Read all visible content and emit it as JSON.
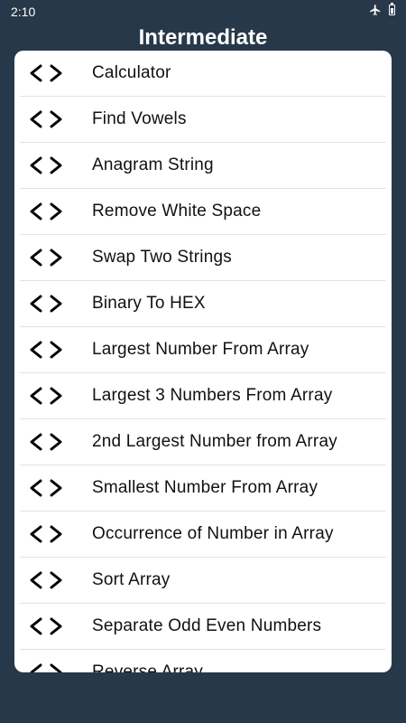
{
  "status_bar": {
    "time": "2:10",
    "icons": [
      "airplane-icon",
      "battery-icon"
    ]
  },
  "header": {
    "title": "Intermediate"
  },
  "list": {
    "items": [
      {
        "label": "Calculator",
        "icon": "code-icon"
      },
      {
        "label": "Find Vowels",
        "icon": "code-icon"
      },
      {
        "label": "Anagram String",
        "icon": "code-icon"
      },
      {
        "label": "Remove White Space",
        "icon": "code-icon"
      },
      {
        "label": "Swap Two Strings",
        "icon": "code-icon"
      },
      {
        "label": "Binary To HEX",
        "icon": "code-icon"
      },
      {
        "label": "Largest Number From Array",
        "icon": "code-icon"
      },
      {
        "label": "Largest 3 Numbers From Array",
        "icon": "code-icon"
      },
      {
        "label": "2nd Largest Number from Array",
        "icon": "code-icon"
      },
      {
        "label": "Smallest Number From Array",
        "icon": "code-icon"
      },
      {
        "label": "Occurrence of Number in Array",
        "icon": "code-icon"
      },
      {
        "label": "Sort Array",
        "icon": "code-icon"
      },
      {
        "label": "Separate Odd Even Numbers",
        "icon": "code-icon"
      },
      {
        "label": "Reverse Array",
        "icon": "code-icon"
      }
    ]
  },
  "colors": {
    "background": "#27384a",
    "card": "#ffffff",
    "text": "#111111",
    "divider": "#e3e3e3"
  }
}
